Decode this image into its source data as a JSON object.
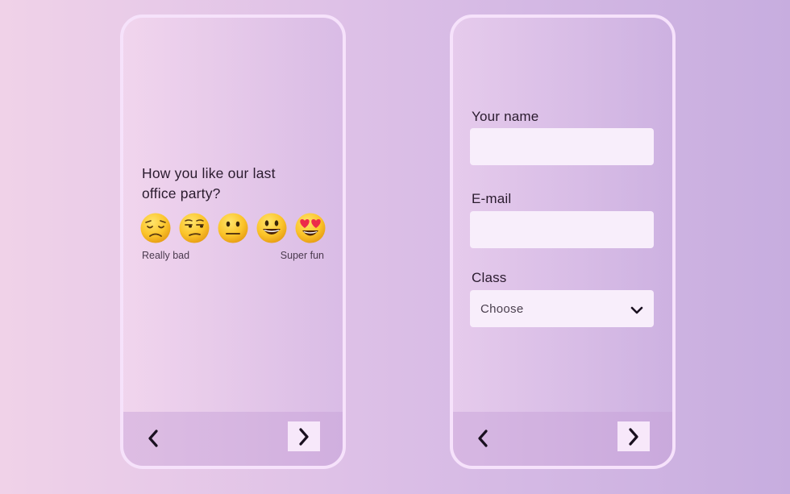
{
  "survey_screen": {
    "question": "How you like our last office party?",
    "rating_options": [
      {
        "icon": "disappointed-face-icon"
      },
      {
        "icon": "unamused-face-icon"
      },
      {
        "icon": "neutral-face-icon"
      },
      {
        "icon": "smiling-face-icon"
      },
      {
        "icon": "heart-eyes-face-icon"
      }
    ],
    "scale_low_label": "Really bad",
    "scale_high_label": "Super fun",
    "nav": {
      "back_icon": "chevron-left-icon",
      "next_icon": "chevron-right-icon"
    }
  },
  "form_screen": {
    "name_label": "Your name",
    "name_value": "",
    "email_label": "E-mail",
    "email_value": "",
    "class_label": "Class",
    "class_selected": "Choose",
    "class_dropdown_icon": "chevron-down-icon",
    "nav": {
      "back_icon": "chevron-left-icon",
      "next_icon": "chevron-right-icon"
    }
  },
  "colors": {
    "background_start": "#f0d2e8",
    "background_end": "#c7addf",
    "phone_border": "#f6e2fb",
    "input_bg": "#f8eefb",
    "text": "#2a1b2e",
    "emoji_face": "#f9c22a"
  }
}
